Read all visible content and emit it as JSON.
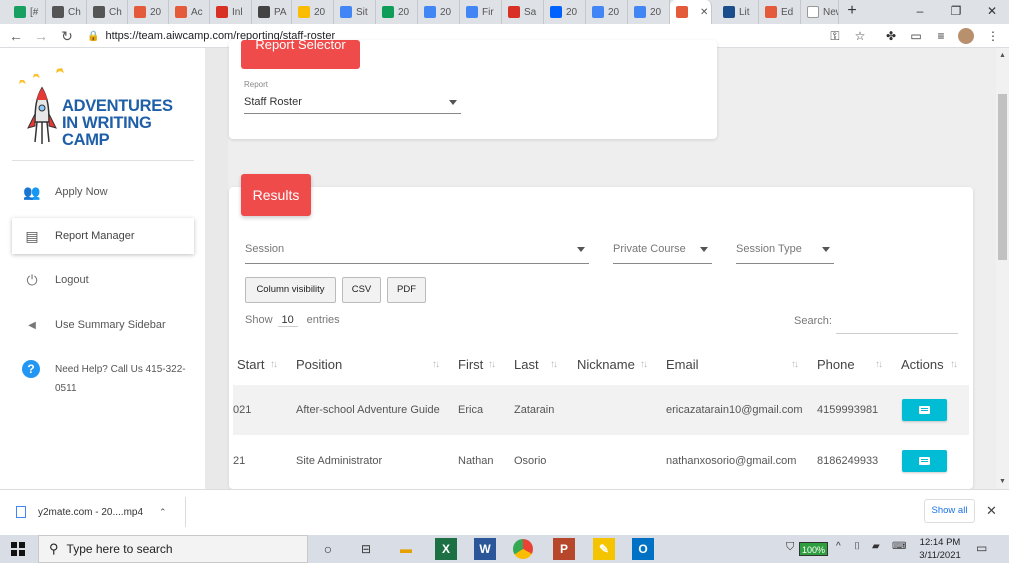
{
  "browser": {
    "tabs": [
      {
        "label": "[#",
        "color": "#18a060"
      },
      {
        "label": "Ch",
        "color": "#555555"
      },
      {
        "label": "Ch",
        "color": "#555555"
      },
      {
        "label": "20",
        "color": "#e35b3b"
      },
      {
        "label": "Ac",
        "color": "#e35b3b"
      },
      {
        "label": "Inl",
        "color": "#d93025"
      },
      {
        "label": "PA",
        "color": "#444444"
      },
      {
        "label": "20",
        "color": "#fbbc04"
      },
      {
        "label": "Sit",
        "color": "#4285f4"
      },
      {
        "label": "20",
        "color": "#0f9d58"
      },
      {
        "label": "20",
        "color": "#4285f4"
      },
      {
        "label": "Fir",
        "color": "#4285f4"
      },
      {
        "label": "Sa",
        "color": "#d93025"
      },
      {
        "label": "20",
        "color": "#0061fe"
      },
      {
        "label": "20",
        "color": "#4285f4"
      },
      {
        "label": "20",
        "color": "#4285f4"
      },
      {
        "label": "",
        "color": "#e35b3b"
      },
      {
        "label": "Lit",
        "color": "#1a4d8c"
      },
      {
        "label": "Ed",
        "color": "#e35b3b"
      },
      {
        "label": "New Ta",
        "color": "#ffffff"
      }
    ],
    "url": "https://team.aiwcamp.com/reporting/staff-roster",
    "controls": {
      "minimize": "–",
      "restore": "❐",
      "close": "✕",
      "newtab": "+"
    }
  },
  "sidebar": {
    "logo_text": "ADVENTURES IN WRITING CAMP",
    "items": [
      {
        "label": "Apply Now",
        "icon": "people-icon"
      },
      {
        "label": "Report Manager",
        "icon": "clipboard-icon"
      },
      {
        "label": "Logout",
        "icon": "plug-icon"
      },
      {
        "label": "Use Summary Sidebar",
        "icon": "chevron-left-icon"
      }
    ],
    "help": "Need Help? Call Us 415-322-0511"
  },
  "report_card": {
    "tag": "Report Selector",
    "report_label": "Report",
    "report_value": "Staff Roster"
  },
  "results": {
    "tag": "Results",
    "filters": {
      "session": "Session",
      "private_course": "Private Course",
      "session_type": "Session Type"
    },
    "buttons": {
      "column_visibility": "Column visibility",
      "csv": "CSV",
      "pdf": "PDF"
    },
    "show_prefix": "Show",
    "show_value": "10",
    "show_suffix": "entries",
    "search_label": "Search:",
    "columns": [
      "Start",
      "Position",
      "First",
      "Last",
      "Nickname",
      "Email",
      "Phone",
      "Actions"
    ],
    "rows": [
      {
        "start": "021",
        "position": "After-school Adventure Guide",
        "first": "Erica",
        "last": "Zatarain",
        "nickname": "",
        "email": "ericazatarain10@gmail.com",
        "phone": "4159993981"
      },
      {
        "start": "21",
        "position": "Site Administrator",
        "first": "Nathan",
        "last": "Osorio",
        "nickname": "",
        "email": "nathanxosorio@gmail.com",
        "phone": "8186249933"
      }
    ]
  },
  "downloads": {
    "file": "y2mate.com - 20....mp4",
    "show_all": "Show all"
  },
  "taskbar": {
    "search_placeholder": "Type here to search",
    "battery": "100%",
    "time": "12:14 PM",
    "date": "3/11/2021"
  }
}
